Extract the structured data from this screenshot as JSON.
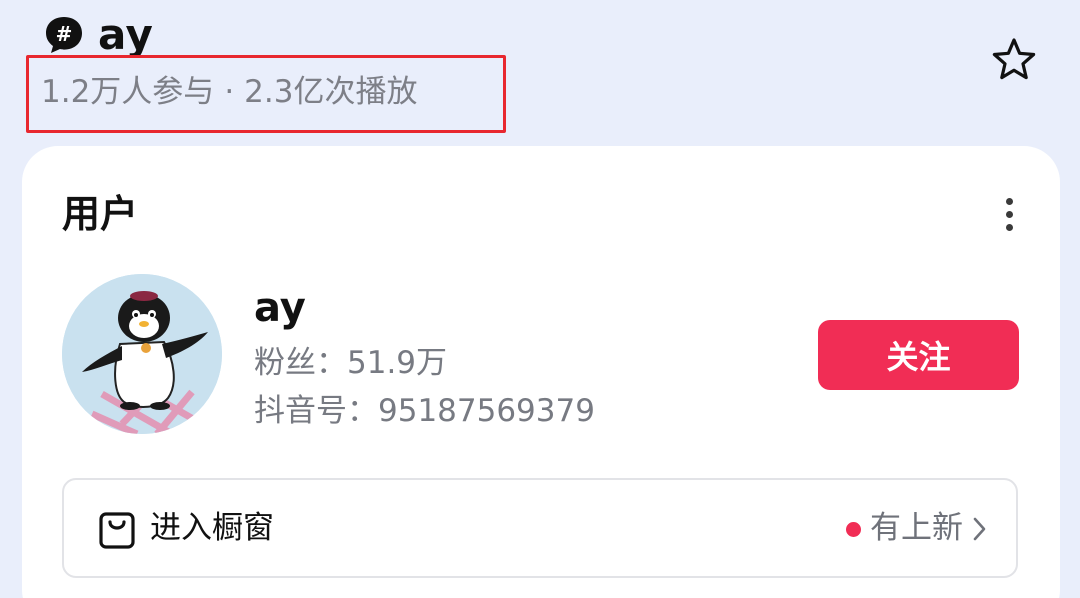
{
  "topic": {
    "title": "ay",
    "participants": "1.2万人参与",
    "separator": "·",
    "plays": "2.3亿次播放",
    "icons": {
      "badge": "hashtag-badge-icon",
      "favorite": "star-outline-icon"
    }
  },
  "users_section": {
    "title": "用户",
    "more_icon": "vertical-ellipsis-icon"
  },
  "user": {
    "name": "ay",
    "fans_label": "粉丝：",
    "fans_value": "51.9万",
    "id_label": "抖音号：",
    "id_value": "95187569379",
    "follow_label": "关注",
    "avatar_icon": "penguin-avatar"
  },
  "shop": {
    "label": "进入橱窗",
    "badge_text": "有上新",
    "icon": "shopping-bag-icon",
    "chevron_icon": "chevron-right-icon"
  },
  "colors": {
    "background": "#e9eefb",
    "accent": "#f12d55",
    "highlight_box": "#e8272f"
  }
}
